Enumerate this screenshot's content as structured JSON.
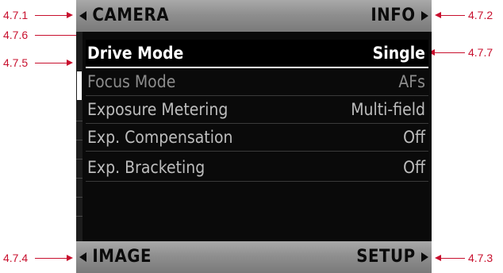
{
  "header": {
    "title": "CAMERA",
    "right_label": "INFO"
  },
  "footer": {
    "left_label": "IMAGE",
    "right_label": "SETUP"
  },
  "menu": [
    {
      "name": "Drive Mode",
      "value": "Single",
      "state": "selected"
    },
    {
      "name": "Focus Mode",
      "value": "AFs",
      "state": "disabled"
    },
    {
      "name": "Exposure Metering",
      "value": "Multi-field",
      "state": "normal"
    },
    {
      "name": "Exp. Compensation",
      "value": "Off",
      "state": "normal"
    },
    {
      "name": "Exp. Bracketing",
      "value": "Off",
      "state": "normal"
    }
  ],
  "callouts": {
    "c1": "4.7.1",
    "c2": "4.7.2",
    "c3": "4.7.3",
    "c4": "4.7.4",
    "c5": "4.7.5",
    "c6": "4.7.6",
    "c7": "4.7.7"
  },
  "colors": {
    "callout": "#c8102e",
    "bar": "#8f8f8f",
    "screen": "#0a0a0a"
  },
  "icons": [
    "left-triangle-icon",
    "right-triangle-icon"
  ]
}
